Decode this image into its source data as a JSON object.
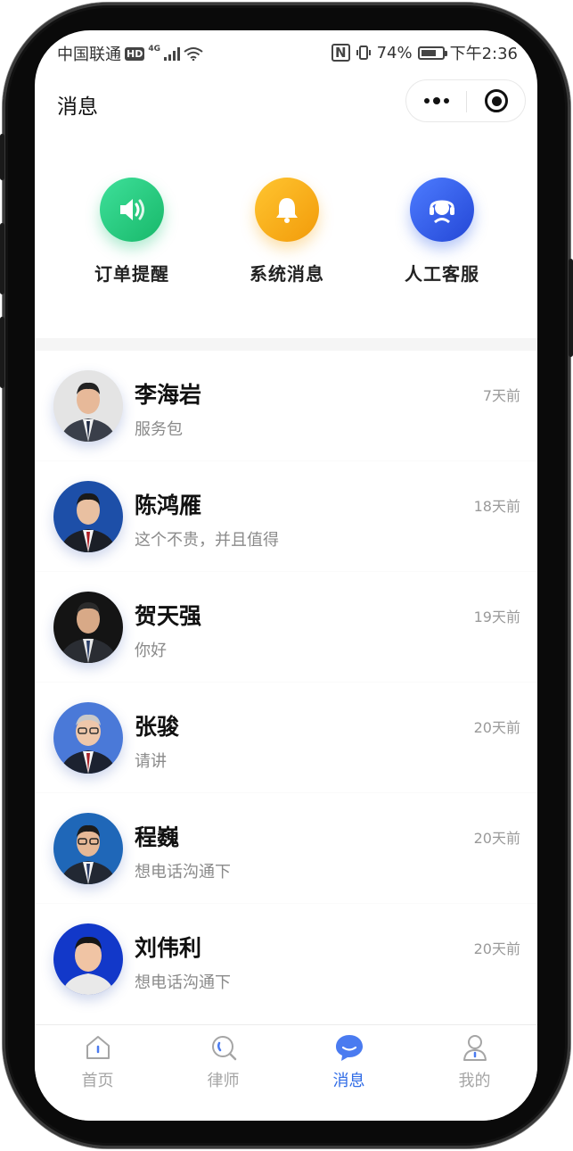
{
  "status_bar": {
    "carrier": "中国联通",
    "hd": "HD",
    "network": "4G",
    "nfc": "N",
    "battery": "74%",
    "battery_level": 0.74,
    "time": "下午2:36"
  },
  "header": {
    "title": "消息"
  },
  "quick_actions": [
    {
      "label": "订单提醒",
      "icon": "speaker-icon",
      "color": "#22c57a"
    },
    {
      "label": "系统消息",
      "icon": "bell-icon",
      "color": "#f7a816"
    },
    {
      "label": "人工客服",
      "icon": "headset-icon",
      "color": "#2f5fe8"
    }
  ],
  "conversations": [
    {
      "name": "李海岩",
      "preview": "服务包",
      "time": "7天前"
    },
    {
      "name": "陈鸿雁",
      "preview": "这个不贵，并且值得",
      "time": "18天前"
    },
    {
      "name": "贺天强",
      "preview": "你好",
      "time": "19天前"
    },
    {
      "name": "张骏",
      "preview": "请讲",
      "time": "20天前"
    },
    {
      "name": "程巍",
      "preview": "想电话沟通下",
      "time": "20天前"
    },
    {
      "name": "刘伟利",
      "preview": "想电话沟通下",
      "time": "20天前"
    }
  ],
  "tabbar": {
    "items": [
      {
        "label": "首页",
        "icon": "home-icon",
        "active": false
      },
      {
        "label": "律师",
        "icon": "search-icon",
        "active": false
      },
      {
        "label": "消息",
        "icon": "chat-icon",
        "active": true
      },
      {
        "label": "我的",
        "icon": "profile-icon",
        "active": false
      }
    ],
    "active_color": "#2f6be6",
    "inactive_color": "#a5a5a5"
  }
}
